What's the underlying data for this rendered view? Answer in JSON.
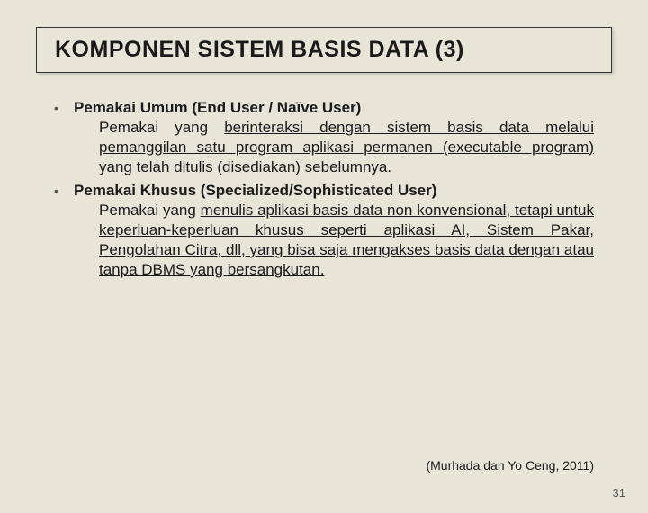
{
  "title": "KOMPONEN SISTEM BASIS DATA (3)",
  "items": [
    {
      "heading": "Pemakai Umum (End User / Naïve User)",
      "desc_plain": "Pemakai yang ",
      "desc_under": "berinteraksi dengan sistem basis data melalui pemanggilan satu program aplikasi permanen (executable program)",
      "desc_tail": " yang telah ditulis (disediakan) sebelumnya."
    },
    {
      "heading": "Pemakai Khusus (Specialized/Sophisticated User)",
      "desc_plain": "Pemakai yang ",
      "desc_under": "menulis aplikasi basis data non konvensional, tetapi untuk keperluan-keperluan khusus seperti aplikasi AI, Sistem Pakar, Pengolahan Citra, dll, yang bisa saja mengakses basis data dengan atau tanpa DBMS yang bersangkutan.",
      "desc_tail": ""
    }
  ],
  "citation": "(Murhada dan Yo Ceng, 2011)",
  "page_number": "31"
}
